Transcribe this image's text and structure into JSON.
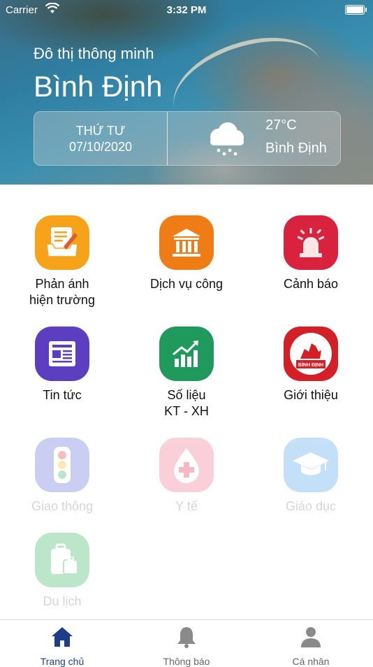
{
  "status": {
    "carrier": "Carrier",
    "time": "3:32 PM"
  },
  "header": {
    "subtitle": "Đô thị thông minh",
    "city": "Bình Định",
    "day": "THỨ TƯ",
    "date": "07/10/2020",
    "temperature": "27°C",
    "weather_city": "Bình Định",
    "weather_icon": "cloud-rain-icon"
  },
  "grid": {
    "items": [
      {
        "label_line1": "Phản ánh",
        "label_line2": "hiện trường",
        "icon": "report-edit-icon",
        "color": "#f6a31a",
        "enabled": true
      },
      {
        "label_line1": "Dịch vụ công",
        "label_line2": "",
        "icon": "government-building-icon",
        "color": "#f07c16",
        "enabled": true
      },
      {
        "label_line1": "Cảnh báo",
        "label_line2": "",
        "icon": "alarm-light-icon",
        "color": "#d8223e",
        "enabled": true
      },
      {
        "label_line1": "Tin tức",
        "label_line2": "",
        "icon": "newspaper-icon",
        "color": "#5b3fc0",
        "enabled": true
      },
      {
        "label_line1": "Số liệu",
        "label_line2": "KT - XH",
        "icon": "growth-chart-icon",
        "color": "#1f9a5c",
        "enabled": true
      },
      {
        "label_line1": "Giới thiệu",
        "label_line2": "",
        "icon": "binh-dinh-emblem-icon",
        "color": "#d41f27",
        "emblem_text": "BÌNH ĐỊNH",
        "enabled": true
      },
      {
        "label_line1": "Giao thông",
        "label_line2": "",
        "icon": "traffic-light-icon",
        "color": "#6b74dc",
        "enabled": false
      },
      {
        "label_line1": "Y tế",
        "label_line2": "",
        "icon": "medical-cross-icon",
        "color": "#f07a93",
        "enabled": false
      },
      {
        "label_line1": "Giáo dục",
        "label_line2": "",
        "icon": "graduation-cap-icon",
        "color": "#5aa7ef",
        "enabled": false
      },
      {
        "label_line1": "Du lịch",
        "label_line2": "",
        "icon": "luggage-icon",
        "color": "#3fb86a",
        "enabled": false
      }
    ]
  },
  "tabbar": {
    "items": [
      {
        "label": "Trang chủ",
        "icon": "home-icon",
        "active": true
      },
      {
        "label": "Thông báo",
        "icon": "bell-icon",
        "active": false
      },
      {
        "label": "Cá nhân",
        "icon": "person-icon",
        "active": false
      }
    ],
    "active_color": "#1c3e88"
  }
}
